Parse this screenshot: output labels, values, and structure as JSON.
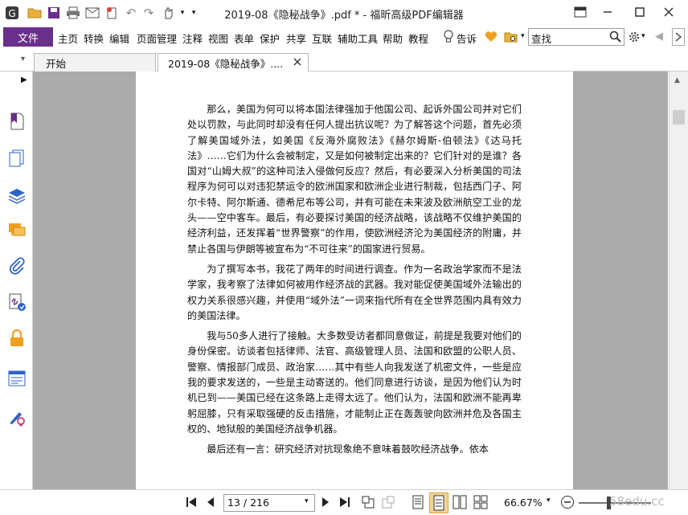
{
  "window": {
    "title": "2019-08《隐秘战争》.pdf * - 福昕高级PDF编辑器"
  },
  "menu": {
    "file": "文件",
    "items": [
      "主页",
      "转换",
      "编辑",
      "页面管理",
      "注释",
      "视图",
      "表单",
      "保护",
      "共享",
      "互联",
      "辅助工具",
      "帮助",
      "教程"
    ],
    "tell_me": "告诉",
    "search_placeholder": "查找"
  },
  "tabs": [
    {
      "label": "开始"
    },
    {
      "label": "2019-08《隐秘战争》...."
    }
  ],
  "document": {
    "paragraphs": [
      "那么，美国为何可以将本国法律强加于他国公司、起诉外国公司并对它们处以罚款，与此同时却没有任何人提出抗议呢？为了解答这个问题，首先必须了解美国域外法，如美国《反海外腐败法》《赫尔姆斯-伯顿法》《达马托法》……它们为什么会被制定，又是如何被制定出来的？它们针对的是谁？各国对“山姆大叔”的这种司法入侵做何反应？然后，有必要深入分析美国的司法程序为何可以对违犯禁运令的欧洲国家和欧洲企业进行制裁，包括西门子、阿尔卡特、阿尔斯通、德希尼布等公司，并有可能在未来波及欧洲航空工业的龙头——空中客车。最后，有必要探讨美国的经济战略，该战略不仅维护美国的经济利益，还发挥着“世界警察”的作用，使欧洲经济沦为美国经济的附庸，并禁止各国与伊朗等被宣布为“不可往来”的国家进行贸易。",
      "为了撰写本书，我花了两年的时间进行调查。作为一名政治学家而不是法学家，我考察了法律如何被用作经济战的武器。我对能促使美国域外法输出的权力关系很感兴趣，并使用“域外法”一词来指代所有在全世界范围内具有效力的美国法律。",
      "我与50多人进行了接触。大多数受访者都同意做证，前提是我要对他们的身份保密。访谈者包括律师、法官、高级管理人员、法国和欧盟的公职人员、警察、情报部门成员、政治家……其中有些人向我发送了机密文件，一些是应我的要求发送的，一些是主动寄送的。他们同意进行访谈，是因为他们认为时机已到——美国已经在这条路上走得太远了。他们认为，法国和欧洲不能再卑躬屈膝，只有采取强硬的反击措施，才能制止正在轰轰驶向欧洲并危及各国主权的、地狱般的美国经济战争机器。",
      "最后还有一言：研究经济对抗现象绝不意味着鼓吹经济战争。依本"
    ]
  },
  "status": {
    "page_indicator": "13 / 216",
    "zoom": "66.67%",
    "zoom_fraction": 0.42
  },
  "watermark": "58edu.cc",
  "colors": {
    "accent": "#6a2f8a",
    "canvas_bg": "#ababab"
  }
}
